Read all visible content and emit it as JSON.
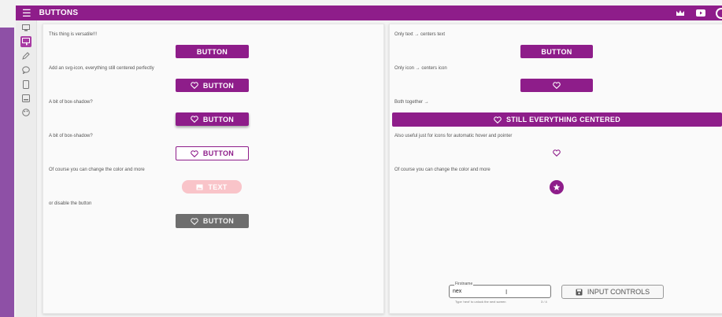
{
  "app": {
    "title": "BUTTONS",
    "menu_icon": "menu-icon",
    "header_icons": [
      "crown-icon",
      "youtube-icon",
      "partial-icon"
    ]
  },
  "rail": {
    "items": [
      "screen-icon",
      "screen-pointer-icon",
      "pencil-icon",
      "chat-icon",
      "phone-icon",
      "card-icon",
      "palette-icon"
    ]
  },
  "left": {
    "rows": [
      {
        "label": "This thing is versatile!!!",
        "button": "BUTTON"
      },
      {
        "label": "Add an svg-icon, everything still centered perfectly",
        "button": "BUTTON",
        "icon": "heart-icon"
      },
      {
        "label": "A bit of box-shadow?",
        "button": "BUTTON",
        "icon": "heart-icon"
      },
      {
        "label": "A bit of box-shadow?",
        "button": "BUTTON",
        "icon": "heart-icon"
      },
      {
        "label": "Of course you can change the color and more",
        "button": "TEXT",
        "icon": "image-icon"
      },
      {
        "label": "or disable the button",
        "button": "BUTTON",
        "icon": "heart-icon"
      }
    ]
  },
  "right": {
    "rows": [
      {
        "label": "Only text → centers text",
        "button": "BUTTON"
      },
      {
        "label": "Only icon → centers icon",
        "icon": "heart-icon"
      },
      {
        "label": "Both together →",
        "button": "STILL EVERYTHING CENTERED",
        "icon": "heart-icon"
      },
      {
        "label": "Also useful just for icons for automatic hover and pointer",
        "icon": "heart-icon"
      },
      {
        "label": "Of course you can change the color and more",
        "icon": "star-icon"
      }
    ],
    "input": {
      "label": "Firstname",
      "value": "nex",
      "hint": "Type 'next' to unlock the next screen",
      "counter": "3 / 4"
    },
    "input_button": "INPUT CONTROLS"
  },
  "colors": {
    "primary": "#8e1d8a",
    "disabled": "#6e6e6e",
    "pink": "#f9c4c9",
    "stripe": "#8e50a6"
  }
}
